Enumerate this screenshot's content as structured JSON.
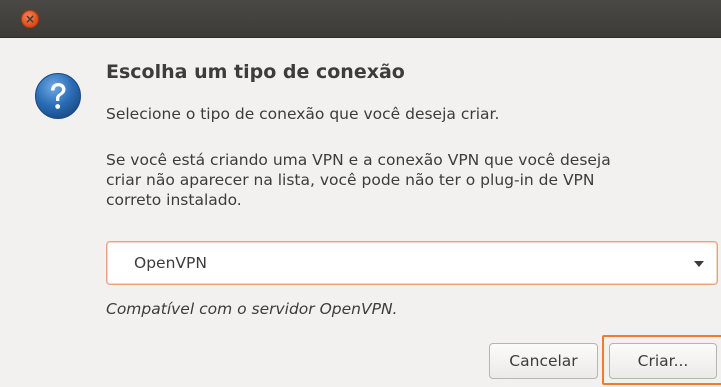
{
  "window": {
    "close_glyph": "×"
  },
  "dialog": {
    "icon": "question-icon",
    "title": "Escolha um tipo de conexão",
    "subtitle": "Selecione o tipo de conexão que você deseja criar.",
    "info_lines": [
      "Se você está criando uma VPN e a conexão VPN que você deseja",
      "criar não aparecer na lista, você pode não ter o plug-in de VPN",
      "correto instalado."
    ],
    "connection_type": {
      "selected": "OpenVPN"
    },
    "description": "Compatível com o servidor OpenVPN.",
    "buttons": {
      "cancel": "Cancelar",
      "create": "Criar..."
    }
  },
  "colors": {
    "accent": "#f07b2b",
    "titlebar": "#3c3b37",
    "close_button": "#df4a16",
    "question_icon": "#2a6db5"
  }
}
